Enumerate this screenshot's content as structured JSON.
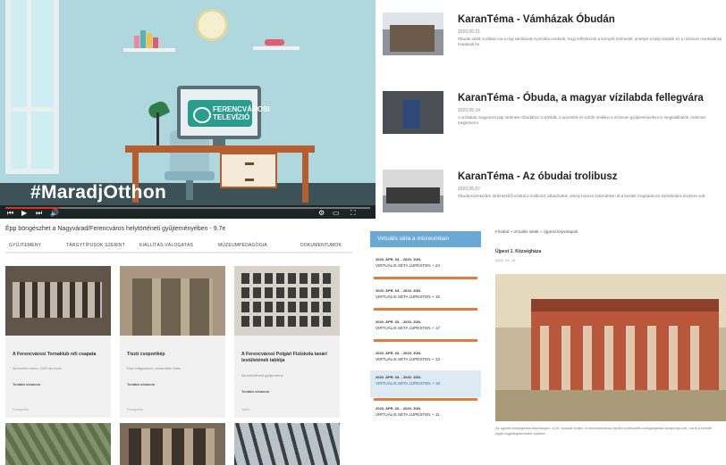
{
  "video": {
    "hashtag": "#MaradjOtthon",
    "monitor_logo_text": "FERENCVÁROSI TELEVÍZIÓ",
    "progress_fraction": 0.15,
    "colors": {
      "wall": "#aed8de",
      "desk": "#b85e2e",
      "logo": "#2a9d8f",
      "progress": "#e52d27"
    }
  },
  "articles": [
    {
      "title": "KaranTéma - Vámházak Óbudán",
      "date": "2020.05.21",
      "excerpt": "Óbudai séták sorában ma a régi vámházak nyomába eredünk, hogy felfedezzük a környék történetét, amelyet a helyi kutatók és a múzeum munkatársai mutatnak be."
    },
    {
      "title": "KaranTéma - Óbuda, a magyar vízilabda fellegvára",
      "date": "2020.05.14",
      "excerpt": "A vízilabda magyarországi története Óbudához is kötődik, a sportolók és edzők emlékei a múzeum gyűjteményében is megtalálhatók, érdemes megismerni."
    },
    {
      "title": "KaranTéma - Az óbudai trolibusz",
      "date": "2020.05.07",
      "excerpt": "Óbuda közlekedési történetéből ezúttal a trolibuszt választottuk, amely hosszú évtizedeken át a kerület meghatározó közlekedési eszköze volt."
    }
  ],
  "gallery": {
    "heading": "Épp böngészhet a Nagyvárad/Ferencváros helytörténeti gyűjteményében - 9.7e",
    "filters": [
      "Gyűjtemény",
      "Tárgytípusok szerint",
      "Kiállítás-válogatás",
      "Múzeumpedagógia",
      "Dokumentumok"
    ],
    "cards": [
      {
        "title": "A Ferencvárosi Tornaklub női csapata",
        "meta": "Ismeretlen fotós, 1920-as évek",
        "button": "Tovább olvasom",
        "footer": "Fotográfia"
      },
      {
        "title": "Tiszti csoportkép",
        "meta": "Első világháború, ismeretlen fotós",
        "button": "Tovább olvasom",
        "footer": "Fotográfia"
      },
      {
        "title": "A Ferencvárosi Polgári Fiúiskola tanári testületének tablója",
        "meta": "Iskolatörténeti gyűjtemény",
        "button": "Tovább olvasom",
        "footer": "Tabló"
      }
    ]
  },
  "walks": {
    "heading": "Virtuális séta a múzeumban",
    "items": [
      {
        "date": "2020. ÁPR. 03. - 2020. JÚN.",
        "title": "VIRTUÁLIS SÉTA ÚJPESTEN + 24"
      },
      {
        "date": "2020. ÁPR. 03. - 2020. JÚN.",
        "title": "VIRTUÁLIS SÉTA ÚJPESTEN + 16"
      },
      {
        "date": "2020. ÁPR. 03. - 2020. JÚN.",
        "title": "VIRTUÁLIS SÉTA ÚJPESTEN + 17"
      },
      {
        "date": "2020. ÁPR. 03. - 2020. JÚN.",
        "title": "VIRTUÁLIS SÉTA ÚJPESTEN + 13"
      },
      {
        "date": "2020. ÁPR. 03. - 2020. JÚN.",
        "title": "VIRTUÁLIS SÉTA ÚJPESTEN + 19"
      },
      {
        "date": "2020. ÁPR. 03. - 2020. JÚN.",
        "title": "VIRTUÁLIS SÉTA ÚJPESTEN + 11"
      }
    ]
  },
  "post": {
    "breadcrumb": "Főoldal » Virtuális séták » Újpesti képeslapok",
    "title": "Újpest 1. Községháza",
    "date": "2020. 04. 15.",
    "caption": "Az újpesti községháza képeslapon, a 20. század elején. A neoreneszánsz épület a település közigazgatási központja volt, ma is a kerület egyik legjellegzetesebb épülete."
  }
}
